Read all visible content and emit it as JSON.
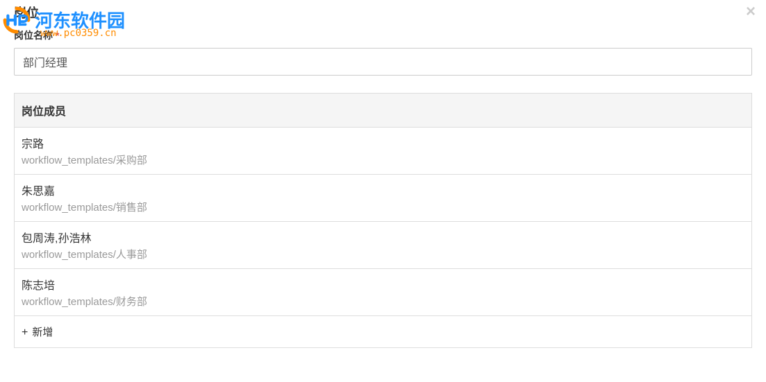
{
  "modal": {
    "title": "岗位"
  },
  "watermark": {
    "brand": "河东软件园",
    "url": "www.pc0359.cn"
  },
  "form": {
    "name_label": "岗位名称",
    "name_value": "部门经理"
  },
  "members": {
    "header": "岗位成员",
    "items": [
      {
        "name": "宗路",
        "path": "workflow_templates/采购部"
      },
      {
        "name": "朱思嘉",
        "path": "workflow_templates/销售部"
      },
      {
        "name": "包周涛,孙浩林",
        "path": "workflow_templates/人事部"
      },
      {
        "name": "陈志培",
        "path": "workflow_templates/财务部"
      }
    ],
    "add_label": "新增"
  }
}
